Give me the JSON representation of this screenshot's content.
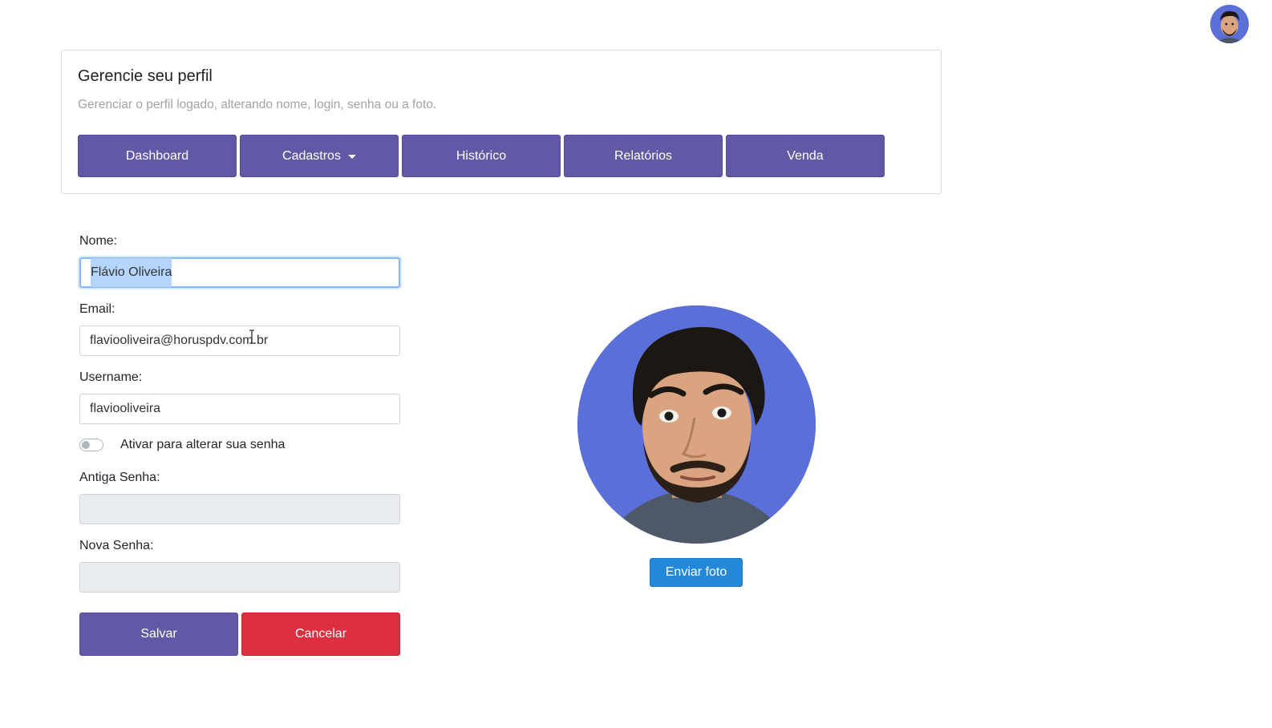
{
  "card": {
    "title": "Gerencie seu perfil",
    "subtitle": "Gerenciar o perfil logado, alterando nome, login, senha ou a foto."
  },
  "nav": {
    "dashboard": "Dashboard",
    "cadastros": "Cadastros",
    "historico": "Histórico",
    "relatorios": "Relatórios",
    "venda": "Venda"
  },
  "form": {
    "name_label": "Nome:",
    "name_value": "Flávio Oliveira",
    "email_label": "Email:",
    "email_value": "flaviooliveira@horuspdv.com.br",
    "username_label": "Username:",
    "username_value": "flaviooliveira",
    "toggle_label": "Ativar para alterar sua senha",
    "old_password_label": "Antiga Senha:",
    "new_password_label": "Nova Senha:"
  },
  "actions": {
    "save": "Salvar",
    "cancel": "Cancelar",
    "upload_photo": "Enviar foto"
  },
  "colors": {
    "primary": "#6259a6",
    "danger": "#dc2f3f",
    "info": "#2488d8",
    "photo_background": "#5b6fd8"
  },
  "icons": {
    "user_avatar": "avatar-photo",
    "dropdown": "caret-down-icon",
    "text_cursor": "i-beam-cursor-icon"
  }
}
